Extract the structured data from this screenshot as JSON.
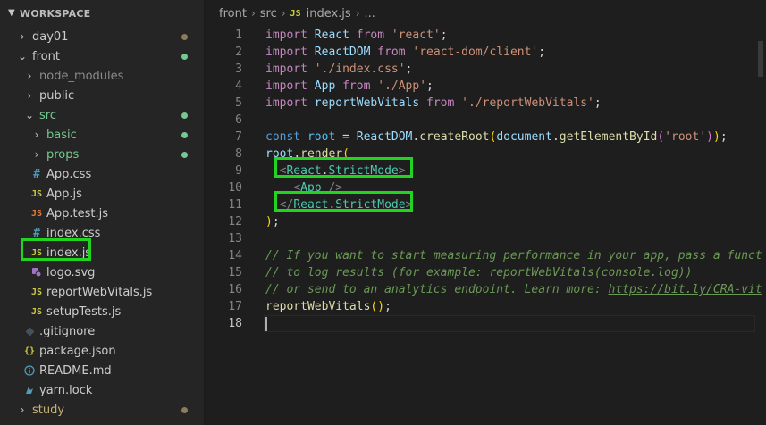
{
  "sidebar": {
    "title": "WORKSPACE",
    "items": [
      {
        "label": "day01",
        "kind": "folder",
        "expanded": false,
        "depth": 0
      },
      {
        "label": "front",
        "kind": "folder",
        "expanded": true,
        "depth": 0
      },
      {
        "label": "node_modules",
        "kind": "folder",
        "expanded": false,
        "depth": 1
      },
      {
        "label": "public",
        "kind": "folder",
        "expanded": false,
        "depth": 1
      },
      {
        "label": "src",
        "kind": "folder",
        "expanded": true,
        "depth": 1
      },
      {
        "label": "basic",
        "kind": "folder",
        "expanded": false,
        "depth": 2
      },
      {
        "label": "props",
        "kind": "folder",
        "expanded": false,
        "depth": 2
      },
      {
        "label": "App.css",
        "kind": "css",
        "icon": "#",
        "depth": 2
      },
      {
        "label": "App.js",
        "kind": "js",
        "icon": "JS",
        "depth": 2
      },
      {
        "label": "App.test.js",
        "kind": "test",
        "icon": "JS",
        "depth": 2
      },
      {
        "label": "index.css",
        "kind": "css",
        "icon": "#",
        "depth": 2
      },
      {
        "label": "index.js",
        "kind": "js",
        "icon": "JS",
        "depth": 2
      },
      {
        "label": "logo.svg",
        "kind": "svg",
        "icon": "svg",
        "depth": 2
      },
      {
        "label": "reportWebVitals.js",
        "kind": "js",
        "icon": "JS",
        "depth": 2
      },
      {
        "label": "setupTests.js",
        "kind": "js",
        "icon": "JS",
        "depth": 2
      },
      {
        "label": ".gitignore",
        "kind": "git",
        "icon": "git",
        "depth": 1
      },
      {
        "label": "package.json",
        "kind": "json",
        "icon": "{}",
        "depth": 1
      },
      {
        "label": "README.md",
        "kind": "info",
        "icon": "i",
        "depth": 1
      },
      {
        "label": "yarn.lock",
        "kind": "yarn",
        "icon": "yarn",
        "depth": 1
      },
      {
        "label": "study",
        "kind": "folder",
        "expanded": false,
        "depth": 0
      }
    ]
  },
  "breadcrumb": {
    "parts": [
      "front",
      "src",
      "index.js",
      "..."
    ],
    "file_badge": "JS"
  },
  "editor": {
    "lines": [
      "1",
      "2",
      "3",
      "4",
      "5",
      "6",
      "7",
      "8",
      "9",
      "10",
      "11",
      "12",
      "13",
      "14",
      "15",
      "16",
      "17",
      "18"
    ],
    "code": {
      "l1": [
        "import",
        "React",
        "from",
        "'react'",
        ";"
      ],
      "l2": [
        "import",
        "ReactDOM",
        "from",
        "'react-dom/client'",
        ";"
      ],
      "l3": [
        "import",
        "'./index.css'",
        ";"
      ],
      "l4": [
        "import",
        "App",
        "from",
        "'./App'",
        ";"
      ],
      "l5": [
        "import",
        "reportWebVitals",
        "from",
        "'./reportWebVitals'",
        ";"
      ],
      "l7": [
        "const",
        "root",
        "=",
        "ReactDOM",
        ".",
        "createRoot",
        "(",
        "document",
        ".",
        "getElementById",
        "(",
        "'root'",
        ")",
        ")",
        ";"
      ],
      "l8": [
        "root",
        ".",
        "render",
        "("
      ],
      "l9": [
        "<",
        "React",
        ".",
        "StrictMode",
        ">"
      ],
      "l10": [
        "<",
        "App",
        "/>"
      ],
      "l11": [
        "</",
        "React",
        ".",
        "StrictMode",
        ">"
      ],
      "l12": [
        ")",
        ";"
      ],
      "l14": "// If you want to start measuring performance in your app, pass a funct",
      "l15": "// to log results (for example: reportWebVitals(console.log))",
      "l16a": "// or send to an analytics endpoint. Learn more: ",
      "l16b": "https://bit.ly/CRA-vit",
      "l17": [
        "reportWebVitals",
        "(",
        ")",
        ";"
      ]
    }
  },
  "colors": {
    "highlight": "#22d322",
    "git_dot_front": "#73c991",
    "git_dot_day01": "#8b7c5e"
  }
}
